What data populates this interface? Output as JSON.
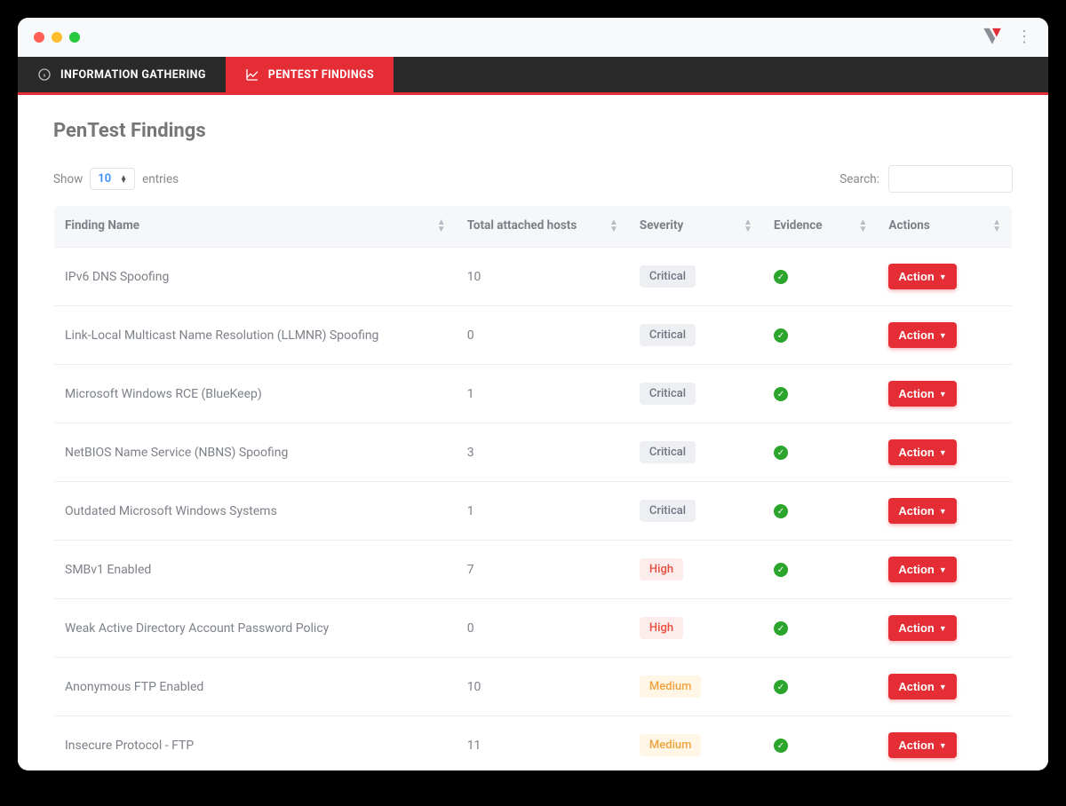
{
  "tabs": [
    {
      "label": "INFORMATION GATHERING",
      "icon": "info-icon",
      "active": false
    },
    {
      "label": "PENTEST FINDINGS",
      "icon": "chart-icon",
      "active": true
    }
  ],
  "page_title": "PenTest Findings",
  "table_controls": {
    "show_label": "Show",
    "entries_label": "entries",
    "entries_value": "10",
    "search_label": "Search:",
    "search_value": ""
  },
  "columns": [
    "Finding Name",
    "Total attached hosts",
    "Severity",
    "Evidence",
    "Actions"
  ],
  "action_button_label": "Action",
  "rows": [
    {
      "name": "IPv6 DNS Spoofing",
      "hosts": "10",
      "severity": "Critical",
      "evidence": true
    },
    {
      "name": "Link-Local Multicast Name Resolution (LLMNR) Spoofing",
      "hosts": "0",
      "severity": "Critical",
      "evidence": true
    },
    {
      "name": "Microsoft Windows RCE (BlueKeep)",
      "hosts": "1",
      "severity": "Critical",
      "evidence": true
    },
    {
      "name": "NetBIOS Name Service (NBNS) Spoofing",
      "hosts": "3",
      "severity": "Critical",
      "evidence": true
    },
    {
      "name": "Outdated Microsoft Windows Systems",
      "hosts": "1",
      "severity": "Critical",
      "evidence": true
    },
    {
      "name": "SMBv1 Enabled",
      "hosts": "7",
      "severity": "High",
      "evidence": true
    },
    {
      "name": "Weak Active Directory Account Password Policy",
      "hosts": "0",
      "severity": "High",
      "evidence": true
    },
    {
      "name": "Anonymous FTP Enabled",
      "hosts": "10",
      "severity": "Medium",
      "evidence": true
    },
    {
      "name": "Insecure Protocol - FTP",
      "hosts": "11",
      "severity": "Medium",
      "evidence": true
    }
  ],
  "colors": {
    "accent": "#e52d35",
    "tab_bg": "#2a2a2a",
    "critical_bg": "#edeff2",
    "critical_fg": "#6f7682",
    "high_bg": "#fdecec",
    "high_fg": "#e74c3c",
    "medium_bg": "#fff6e6",
    "medium_fg": "#f0a33f",
    "evidence_check": "#2ba52b"
  }
}
